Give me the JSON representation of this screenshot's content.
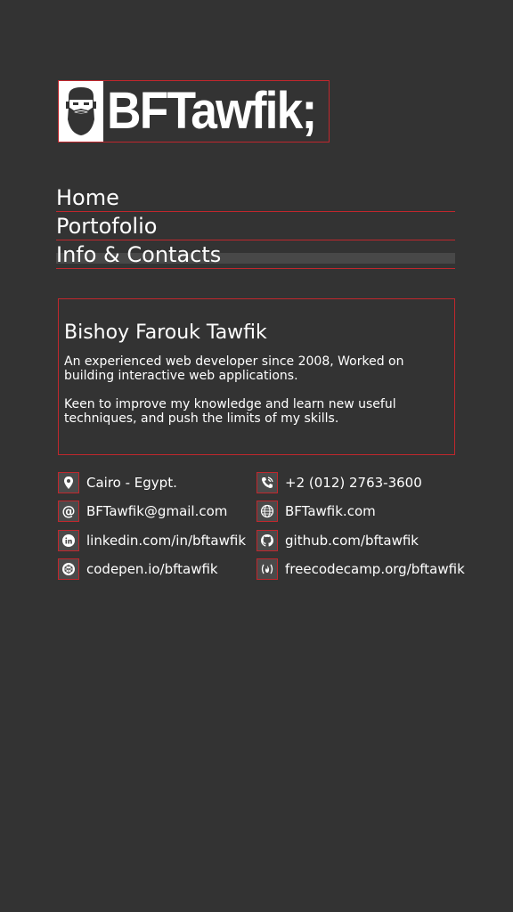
{
  "brand": {
    "logo_text": "BFTawfik;"
  },
  "nav": {
    "items": [
      {
        "label": "Home"
      },
      {
        "label": "Portofolio"
      },
      {
        "label": "Info & Contacts"
      }
    ],
    "active_index": 2
  },
  "profile": {
    "name": "Bishoy Farouk Tawfik",
    "paragraphs": [
      "An experienced web developer since 2008, Worked on building interactive web applications.",
      "Keen to improve my knowledge and learn new useful techniques, and push the limits of my skills."
    ]
  },
  "contacts": [
    {
      "icon": "location-pin-icon",
      "text": "Cairo - Egypt."
    },
    {
      "icon": "phone-icon",
      "text": "+2 (012) 2763-3600"
    },
    {
      "icon": "at-sign-icon",
      "text": "BFTawfik@gmail.com"
    },
    {
      "icon": "globe-icon",
      "text": "BFTawfik.com"
    },
    {
      "icon": "linkedin-icon",
      "text": "linkedin.com/in/bftawfik"
    },
    {
      "icon": "github-icon",
      "text": "github.com/bftawfik"
    },
    {
      "icon": "codepen-icon",
      "text": "codepen.io/bftawfik"
    },
    {
      "icon": "freecodecamp-icon",
      "text": "freecodecamp.org/bftawfik"
    }
  ],
  "colors": {
    "background": "#333333",
    "accent": "#c0272d",
    "text": "#ffffff"
  }
}
